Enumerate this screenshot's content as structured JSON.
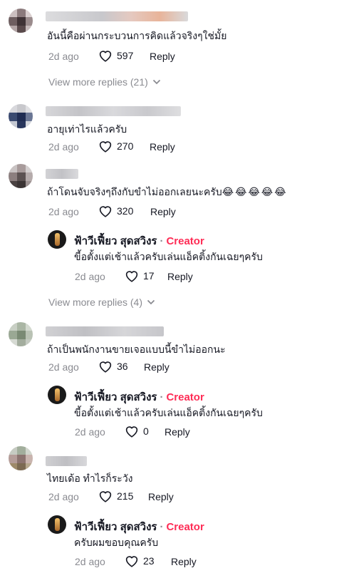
{
  "colors": {
    "creator_accent": "#fe2c55",
    "meta": "#8a8b91",
    "text": "#161823"
  },
  "comments": [
    {
      "text": "อันนี้คือผ่านกระบวนการคิดแล้วจริงๆใช่มั้ย",
      "time": "2d ago",
      "likes": "597",
      "reply_label": "Reply",
      "view_more": "View more replies (21)"
    },
    {
      "text": "อายุเท่าไรแล้วครับ",
      "time": "2d ago",
      "likes": "270",
      "reply_label": "Reply"
    },
    {
      "text": "ถ้าโดนจับจริงๆถึงกับขำไม่ออกเลยนะครับ",
      "emoji": "😂😂😂😂😂",
      "time": "2d ago",
      "likes": "320",
      "reply_label": "Reply",
      "reply": {
        "author": "ฟ้าวีเฟี้ยว สุดสวิงร",
        "badge": "Creator",
        "text": "ขี้อตั้งแต่เช้าแล้วครับเล่นแอ็คติ้งกันเฉยๆครับ",
        "time": "2d ago",
        "likes": "17",
        "reply_label": "Reply"
      },
      "view_more": "View more replies (4)"
    },
    {
      "text": "ถ้าเป็นพนักงานขายเจอแบบนี้ขำไม่ออกนะ",
      "time": "2d ago",
      "likes": "36",
      "reply_label": "Reply",
      "reply": {
        "author": "ฟ้าวีเฟี้ยว สุดสวิงร",
        "badge": "Creator",
        "text": "ขี้อตั้งแต่เช้าแล้วครับเล่นแอ็คติ้งกันเฉยๆครับ",
        "time": "2d ago",
        "likes": "0",
        "reply_label": "Reply"
      }
    },
    {
      "text": "ไทยเด้อ ทำไรก็ระวัง",
      "time": "2d ago",
      "likes": "215",
      "reply_label": "Reply",
      "reply": {
        "author": "ฟ้าวีเฟี้ยว สุดสวิงร",
        "badge": "Creator",
        "text": "ครับผมขอบคุณครับ",
        "time": "2d ago",
        "likes": "23",
        "reply_label": "Reply"
      }
    }
  ]
}
